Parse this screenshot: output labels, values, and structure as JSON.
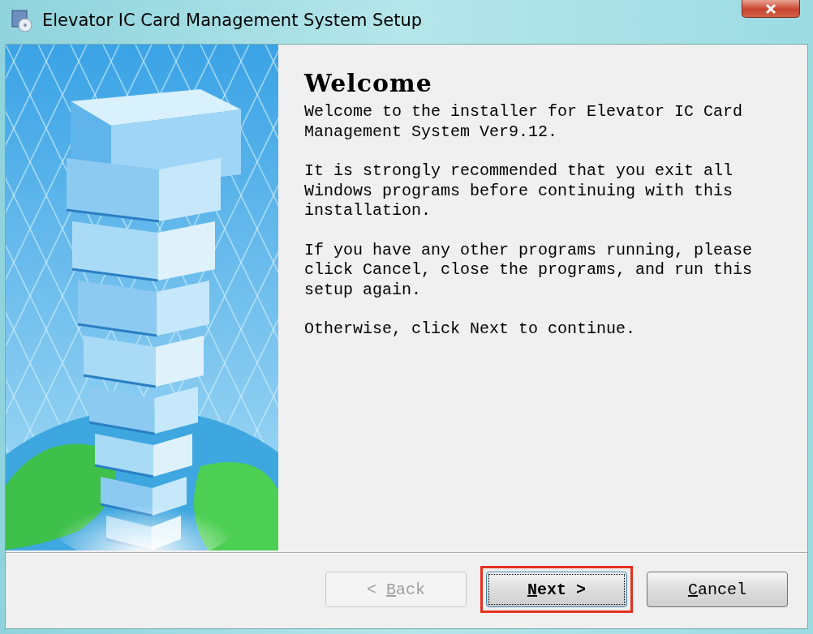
{
  "window": {
    "title": "Elevator IC Card Management System Setup"
  },
  "heading": "Welcome",
  "paragraphs": [
    "Welcome to the installer for Elevator IC Card Management System Ver9.12.",
    "It is strongly recommended that you exit all Windows programs before continuing with this installation.",
    "If you have any other programs running, please click Cancel, close the programs, and run this setup again.",
    "Otherwise, click Next to continue."
  ],
  "buttons": [
    {
      "prefix": "< ",
      "key": "B",
      "rest": "ack",
      "disabled": true,
      "focused": false,
      "highlighted": false
    },
    {
      "key": "N",
      "rest": "ext >",
      "disabled": false,
      "focused": true,
      "highlighted": true
    },
    {
      "key": "C",
      "rest": "ancel",
      "disabled": false,
      "focused": false,
      "highlighted": false
    }
  ]
}
